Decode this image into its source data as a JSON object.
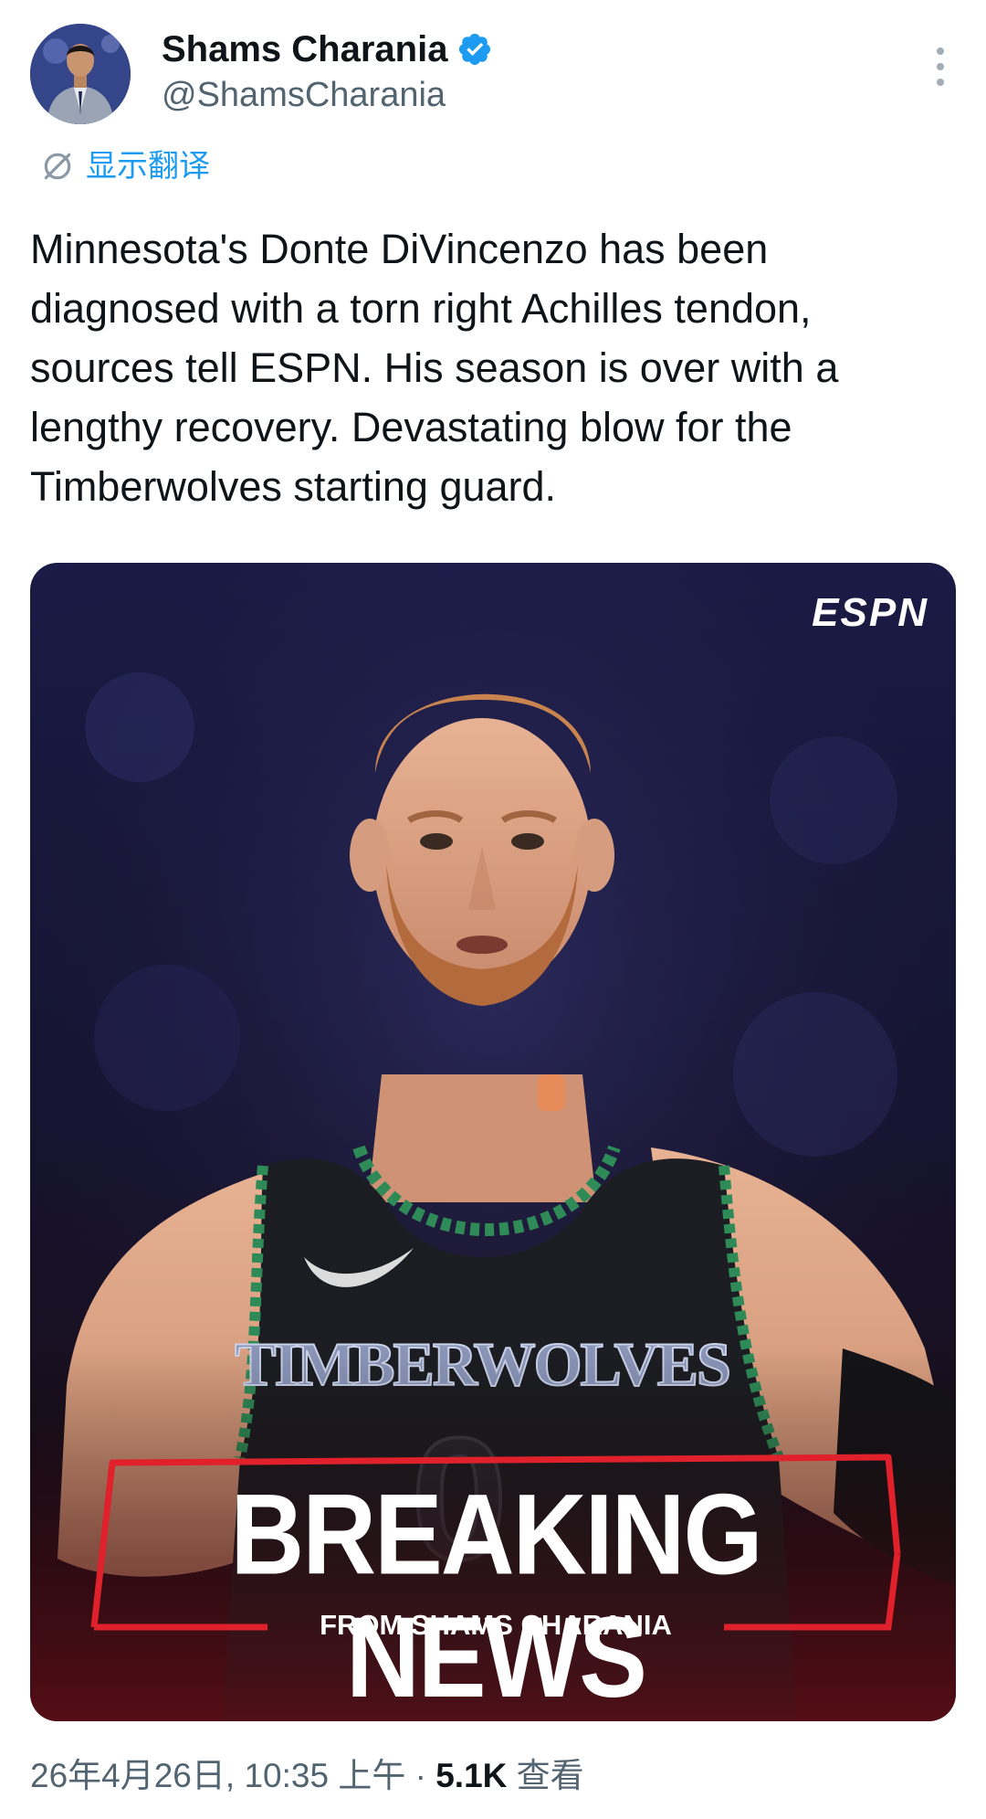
{
  "author": {
    "display_name": "Shams Charania",
    "handle": "@ShamsCharania",
    "avatar_icon": "profile-photo",
    "verified_icon": "verified-badge-icon",
    "verified_color": "#1d9bf0"
  },
  "translate": {
    "label": "显示翻译",
    "icon": "translate-globe-icon"
  },
  "tweet": {
    "text": "Minnesota's Donte DiVincenzo has been diagnosed with a torn right Achilles tendon, sources tell ESPN. His season is over with a lengthy recovery. Devastating blow for the Timberwolves starting guard."
  },
  "media": {
    "logo_text": "ESPN",
    "headline": "BREAKING NEWS",
    "subline": "FROM SHAMS CHARANIA",
    "jersey_text": "TIMBERWOLVES",
    "jersey_number": "0",
    "frame_color": "#e0202a"
  },
  "meta": {
    "timestamp": "26年4月26日, 10:35 上午",
    "separator": "·",
    "views_count": "5.1K",
    "views_label": "查看"
  },
  "colors": {
    "text_primary": "#0f1419",
    "text_secondary": "#536471",
    "link": "#1d9bf0"
  }
}
